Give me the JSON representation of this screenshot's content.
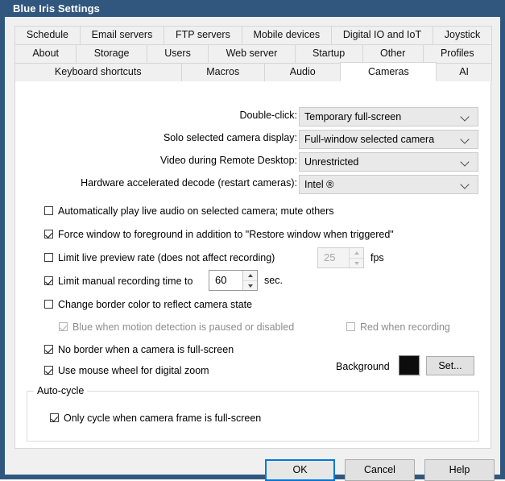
{
  "window": {
    "title": "Blue Iris Settings"
  },
  "tabs": {
    "row1": [
      {
        "label": "Schedule",
        "active": false
      },
      {
        "label": "Email servers",
        "active": false
      },
      {
        "label": "FTP servers",
        "active": false
      },
      {
        "label": "Mobile devices",
        "active": false
      },
      {
        "label": "Digital IO and IoT",
        "active": false
      },
      {
        "label": "Joystick",
        "active": false
      }
    ],
    "row2": [
      {
        "label": "About",
        "active": false
      },
      {
        "label": "Storage",
        "active": false
      },
      {
        "label": "Users",
        "active": false
      },
      {
        "label": "Web server",
        "active": false
      },
      {
        "label": "Startup",
        "active": false
      },
      {
        "label": "Other",
        "active": false
      },
      {
        "label": "Profiles",
        "active": false
      }
    ],
    "row3": [
      {
        "label": "Keyboard shortcuts",
        "active": false
      },
      {
        "label": "Macros",
        "active": false
      },
      {
        "label": "Audio",
        "active": false
      },
      {
        "label": "Cameras",
        "active": true
      },
      {
        "label": "AI",
        "active": false
      }
    ]
  },
  "combos": [
    {
      "label": "Double-click:",
      "value": "Temporary full-screen",
      "icon": "chevron-down-icon"
    },
    {
      "label": "Solo selected camera display:",
      "value": "Full-window selected camera",
      "icon": "chevron-down-icon"
    },
    {
      "label": "Video during Remote Desktop:",
      "value": "Unrestricted",
      "icon": "chevron-down-icon"
    },
    {
      "label": "Hardware accelerated decode (restart cameras):",
      "value": "Intel ®",
      "icon": "chevron-down-icon"
    }
  ],
  "checkboxes": {
    "auto_audio": {
      "label": "Automatically play live audio on selected camera; mute others",
      "checked": false,
      "disabled": false
    },
    "force_foreground": {
      "label": "Force window to foreground in addition to \"Restore window when triggered\"",
      "checked": true,
      "disabled": false
    },
    "limit_preview": {
      "label": "Limit live preview rate (does not affect recording)",
      "checked": false,
      "disabled": false
    },
    "limit_manual": {
      "label": "Limit manual recording time to",
      "checked": true,
      "disabled": false
    },
    "border_color": {
      "label": "Change border color to reflect camera state",
      "checked": false,
      "disabled": false
    },
    "blue_paused": {
      "label": "Blue when motion detection is paused or disabled",
      "checked": true,
      "disabled": true
    },
    "red_recording": {
      "label": "Red when recording",
      "checked": false,
      "disabled": true
    },
    "no_border": {
      "label": "No border when a camera is full-screen",
      "checked": true,
      "disabled": false
    },
    "mouse_wheel": {
      "label": "Use mouse wheel for digital zoom",
      "checked": true,
      "disabled": false
    },
    "only_cycle": {
      "label": "Only cycle when camera frame is full-screen",
      "checked": true,
      "disabled": false
    }
  },
  "spinners": {
    "fps": {
      "value": "25",
      "unit": "fps",
      "disabled": true
    },
    "sec": {
      "value": "60",
      "unit": "sec.",
      "disabled": false
    }
  },
  "background": {
    "label": "Background",
    "color": "#0d0d0d",
    "set_label": "Set..."
  },
  "group": {
    "legend": "Auto-cycle"
  },
  "buttons": {
    "ok": "OK",
    "cancel": "Cancel",
    "help": "Help"
  },
  "colors": {
    "title_bar": "#31577f",
    "accent": "#0078d7",
    "panel": "#ffffff",
    "dialog": "#f0f0f0"
  }
}
